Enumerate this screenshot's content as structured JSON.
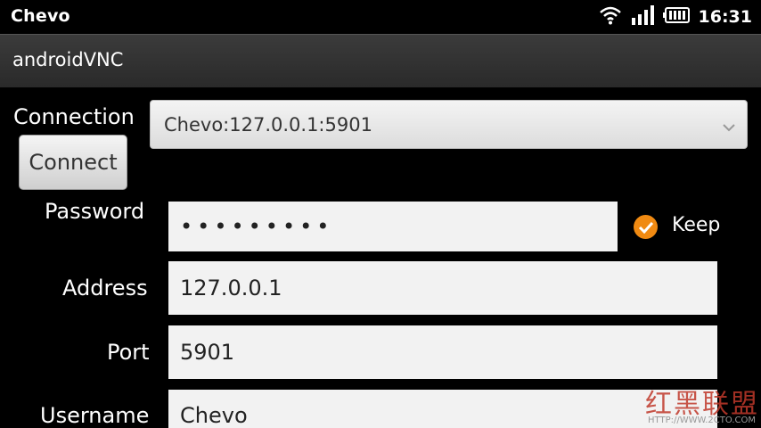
{
  "status": {
    "title": "Chevo",
    "time": "16:31"
  },
  "app": {
    "title": "androidVNC"
  },
  "connection": {
    "label": "Connection",
    "selected": "Chevo:127.0.0.1:5901"
  },
  "connect_label": "Connect",
  "password": {
    "label": "Password",
    "value": "•••••••••"
  },
  "keep": {
    "label": "Keep",
    "checked": true,
    "color": "#f08a12"
  },
  "address": {
    "label": "Address",
    "value": "127.0.0.1"
  },
  "port": {
    "label": "Port",
    "value": "5901"
  },
  "username": {
    "label": "Username",
    "value": "Chevo"
  },
  "watermark": {
    "text": "红黑联盟",
    "url": "HTTP://WWW.2CTO.COM"
  }
}
